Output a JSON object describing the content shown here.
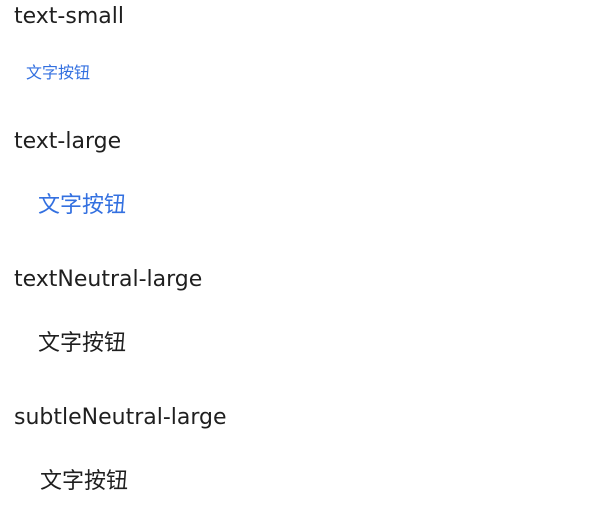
{
  "colors": {
    "brand": "#3370e0",
    "neutral": "#1f1f1f"
  },
  "sections": [
    {
      "label": "text-small",
      "button": "文字按钮"
    },
    {
      "label": "text-large",
      "button": "文字按钮"
    },
    {
      "label": "textNeutral-large",
      "button": "文字按钮"
    },
    {
      "label": "subtleNeutral-large",
      "button": "文字按钮"
    }
  ]
}
